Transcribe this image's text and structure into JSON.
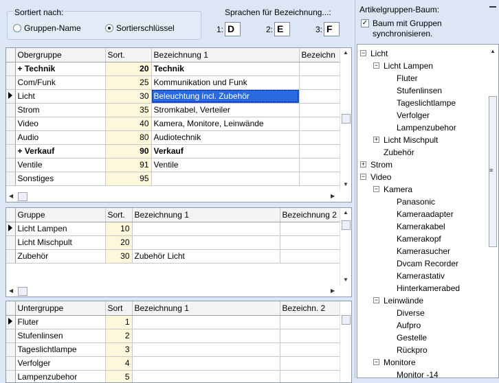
{
  "sort": {
    "title": "Sortiert nach:",
    "option1": "Gruppen-Name",
    "option2": "Sortierschlüssel",
    "selected": "Sortierschlüssel"
  },
  "languages": {
    "title": "Sprachen für Bezeichnung...:",
    "items": [
      {
        "label": "1:",
        "value": "D"
      },
      {
        "label": "2:",
        "value": "E"
      },
      {
        "label": "3:",
        "value": "F"
      }
    ]
  },
  "grid1": {
    "headers": [
      "Obergruppe",
      "Sort.",
      "Bezeichnung 1",
      "Bezeichn"
    ],
    "rows": [
      {
        "name": "+ Technik",
        "sort": "20",
        "desc": "Technik",
        "bold": true
      },
      {
        "name": "Com/Funk",
        "sort": "25",
        "desc": "Kommunikation und Funk"
      },
      {
        "name": "Licht",
        "sort": "30",
        "desc": "Beleuchtung incl. Zubehör",
        "current": true
      },
      {
        "name": "Strom",
        "sort": "35",
        "desc": "Stromkabel, Verteiler"
      },
      {
        "name": "Video",
        "sort": "40",
        "desc": "Kamera, Monitore, Leinwände"
      },
      {
        "name": "Audio",
        "sort": "80",
        "desc": "Audiotechnik"
      },
      {
        "name": "+ Verkauf",
        "sort": "90",
        "desc": "Verkauf",
        "bold": true
      },
      {
        "name": "Ventile",
        "sort": "91",
        "desc": "Ventile"
      },
      {
        "name": "Sonstiges",
        "sort": "95",
        "desc": ""
      }
    ]
  },
  "grid2": {
    "headers": [
      "Gruppe",
      "Sort.",
      "Bezeichnung 1",
      "Bezeichnung 2"
    ],
    "rows": [
      {
        "name": "Licht Lampen",
        "sort": "10",
        "desc": "",
        "current": true
      },
      {
        "name": "Licht Mischpult",
        "sort": "20",
        "desc": ""
      },
      {
        "name": "Zubehör",
        "sort": "30",
        "desc": "Zubehör Licht"
      }
    ]
  },
  "grid3": {
    "headers": [
      "Untergruppe",
      "Sort",
      "Bezeichnung 1",
      "Bezeichn. 2"
    ],
    "rows": [
      {
        "name": "Fluter",
        "sort": "1",
        "desc": "",
        "current": true
      },
      {
        "name": "Stufenlinsen",
        "sort": "2",
        "desc": ""
      },
      {
        "name": "Tageslichtlampe",
        "sort": "3",
        "desc": ""
      },
      {
        "name": "Verfolger",
        "sort": "4",
        "desc": ""
      },
      {
        "name": "Lampenzubehor",
        "sort": "5",
        "desc": ""
      }
    ]
  },
  "tree_panel": {
    "title": "Artikelgruppen-Baum:",
    "sync_label": "Baum mit Gruppen synchronisieren.",
    "sync_checked": true,
    "nodes": [
      {
        "label": "Licht",
        "level": 0,
        "box": "-"
      },
      {
        "label": "Licht Lampen",
        "level": 1,
        "box": "-"
      },
      {
        "label": "Fluter",
        "level": 2
      },
      {
        "label": "Stufenlinsen",
        "level": 2
      },
      {
        "label": "Tageslichtlampe",
        "level": 2
      },
      {
        "label": "Verfolger",
        "level": 2
      },
      {
        "label": "Lampenzubehor",
        "level": 2
      },
      {
        "label": "Licht Mischpult",
        "level": 1,
        "box": "+"
      },
      {
        "label": "Zubehör",
        "level": 1
      },
      {
        "label": "Strom",
        "level": 0,
        "box": "+"
      },
      {
        "label": "Video",
        "level": 0,
        "box": "-"
      },
      {
        "label": "Kamera",
        "level": 1,
        "box": "-"
      },
      {
        "label": "Panasonic",
        "level": 2
      },
      {
        "label": "Kameraadapter",
        "level": 2
      },
      {
        "label": "Kamerakabel",
        "level": 2
      },
      {
        "label": "Kamerakopf",
        "level": 2
      },
      {
        "label": "Kamerasucher",
        "level": 2
      },
      {
        "label": "Dvcam Recorder",
        "level": 2
      },
      {
        "label": "Kamerastativ",
        "level": 2
      },
      {
        "label": "Hinterkamerabed",
        "level": 2
      },
      {
        "label": "Leinwände",
        "level": 1,
        "box": "-"
      },
      {
        "label": "Diverse",
        "level": 2
      },
      {
        "label": "Aufpro",
        "level": 2
      },
      {
        "label": "Gestelle",
        "level": 2
      },
      {
        "label": "Rückpro",
        "level": 2
      },
      {
        "label": "Monitore",
        "level": 1,
        "box": "-"
      },
      {
        "label": "Monitor -14",
        "level": 2
      }
    ]
  }
}
